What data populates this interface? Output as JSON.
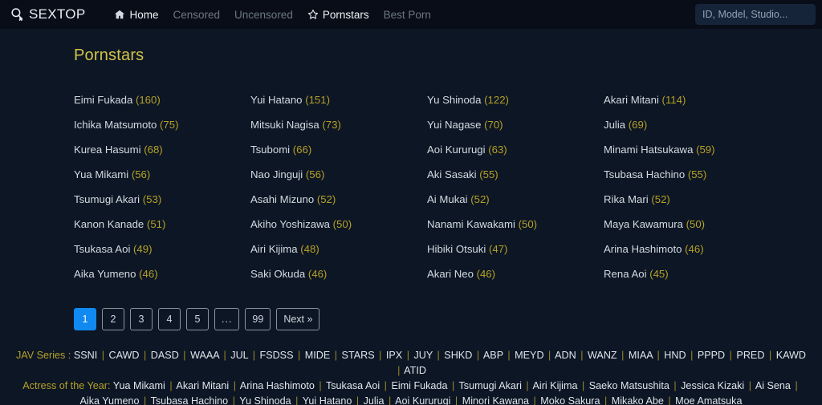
{
  "header": {
    "logo_text": "SEXTOP",
    "logo_icon": "search-female-symbol-icon",
    "nav": [
      {
        "label": "Home",
        "icon": "home-icon",
        "active": true
      },
      {
        "label": "Censored",
        "icon": "",
        "active": false
      },
      {
        "label": "Uncensored",
        "icon": "",
        "active": false
      },
      {
        "label": "Pornstars",
        "icon": "star-icon",
        "active": true
      },
      {
        "label": "Best Porn",
        "icon": "",
        "active": false
      }
    ],
    "search": {
      "placeholder": "ID, Model, Studio...",
      "value": ""
    }
  },
  "page": {
    "title": "Pornstars"
  },
  "pornstars": [
    {
      "name": "Eimi Fukada",
      "count": "(160)"
    },
    {
      "name": "Yui Hatano",
      "count": "(151)"
    },
    {
      "name": "Yu Shinoda",
      "count": "(122)"
    },
    {
      "name": "Akari Mitani",
      "count": "(114)"
    },
    {
      "name": "Ichika Matsumoto",
      "count": "(75)"
    },
    {
      "name": "Mitsuki Nagisa",
      "count": "(73)"
    },
    {
      "name": "Yui Nagase",
      "count": "(70)"
    },
    {
      "name": "Julia",
      "count": "(69)"
    },
    {
      "name": "Kurea Hasumi",
      "count": "(68)"
    },
    {
      "name": "Tsubomi",
      "count": "(66)"
    },
    {
      "name": "Aoi Kururugi",
      "count": "(63)"
    },
    {
      "name": "Minami Hatsukawa",
      "count": "(59)"
    },
    {
      "name": "Yua Mikami",
      "count": "(56)"
    },
    {
      "name": "Nao Jinguji",
      "count": "(56)"
    },
    {
      "name": "Aki Sasaki",
      "count": "(55)"
    },
    {
      "name": "Tsubasa Hachino",
      "count": "(55)"
    },
    {
      "name": "Tsumugi Akari",
      "count": "(53)"
    },
    {
      "name": "Asahi Mizuno",
      "count": "(52)"
    },
    {
      "name": "Ai Mukai",
      "count": "(52)"
    },
    {
      "name": "Rika Mari",
      "count": "(52)"
    },
    {
      "name": "Kanon Kanade",
      "count": "(51)"
    },
    {
      "name": "Akiho Yoshizawa",
      "count": "(50)"
    },
    {
      "name": "Nanami Kawakami",
      "count": "(50)"
    },
    {
      "name": "Maya Kawamura",
      "count": "(50)"
    },
    {
      "name": "Tsukasa Aoi",
      "count": "(49)"
    },
    {
      "name": "Airi Kijima",
      "count": "(48)"
    },
    {
      "name": "Hibiki Otsuki",
      "count": "(47)"
    },
    {
      "name": "Arina Hashimoto",
      "count": "(46)"
    },
    {
      "name": "Aika Yumeno",
      "count": "(46)"
    },
    {
      "name": "Saki Okuda",
      "count": "(46)"
    },
    {
      "name": "Akari Neo",
      "count": "(46)"
    },
    {
      "name": "Rena Aoi",
      "count": "(45)"
    }
  ],
  "pagination": {
    "pages": [
      "1",
      "2",
      "3",
      "4",
      "5",
      "...",
      "99"
    ],
    "active_index": 0,
    "next_label": "Next »"
  },
  "footer": {
    "jav_series_label": "JAV Series :",
    "jav_series": [
      "SSNI",
      "CAWD",
      "DASD",
      "WAAA",
      "JUL",
      "FSDSS",
      "MIDE",
      "STARS",
      "IPX",
      "JUY",
      "SHKD",
      "ABP",
      "MEYD",
      "ADN",
      "WANZ",
      "MIAA",
      "HND",
      "PPPD",
      "PRED",
      "KAWD",
      "ATID"
    ],
    "actress_label": "Actress of the Year:",
    "actresses": [
      "Yua Mikami",
      "Akari Mitani",
      "Arina Hashimoto",
      "Tsukasa Aoi",
      "Eimi Fukada",
      "Tsumugi Akari",
      "Airi Kijima",
      "Saeko Matsushita",
      "Jessica Kizaki",
      "Ai Sena",
      "Aika Yumeno",
      "Tsubasa Hachino",
      "Yu Shinoda",
      "Yui Hatano",
      "Julia",
      "Aoi Kururugi",
      "Minori Kawana",
      "Moko Sakura",
      "Mikako Abe",
      "Moe Amatsuka"
    ]
  },
  "colors": {
    "topbar_bg": "#080d17",
    "page_bg": "#0d1624",
    "accent_yellow": "#d2c34a",
    "count_yellow": "#b5a128",
    "active_blue": "#1089f0",
    "text_primary": "#d3dae2",
    "nav_dim": "#6d7783"
  }
}
